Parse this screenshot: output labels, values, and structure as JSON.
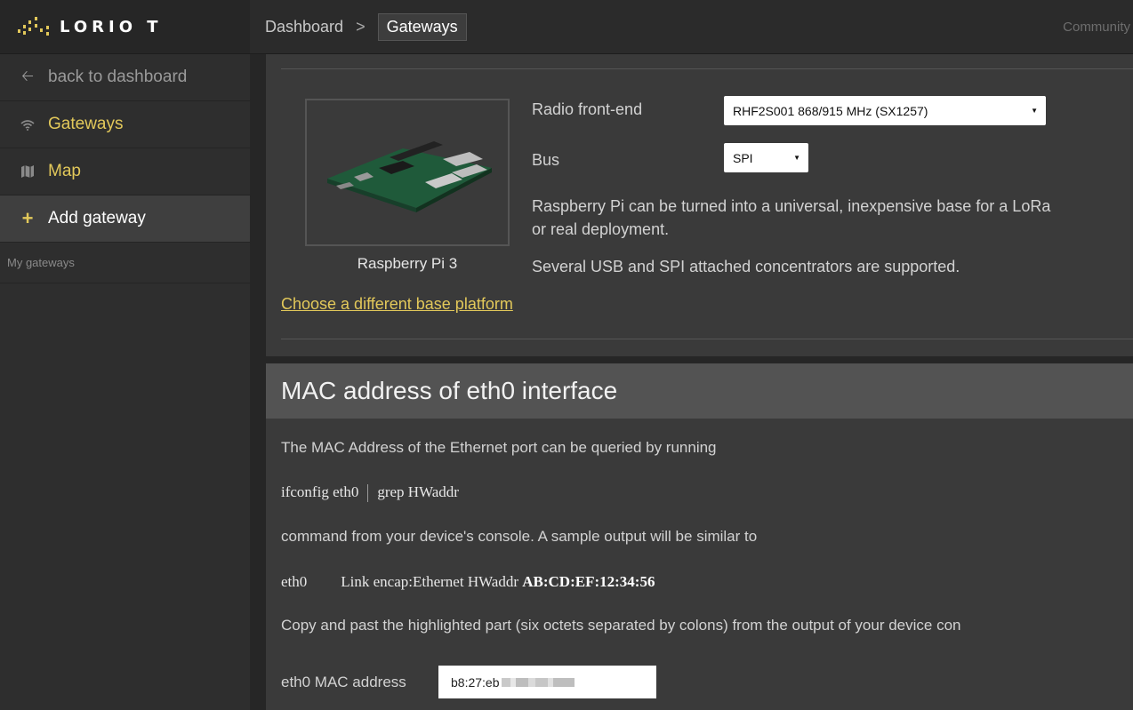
{
  "brand": {
    "logo_text": "LORIO T"
  },
  "sidebar": {
    "back": "back to dashboard",
    "gateways": "Gateways",
    "map": "Map",
    "add_gateway": "Add gateway",
    "section_my_gateways": "My gateways"
  },
  "header": {
    "crumb_dashboard": "Dashboard",
    "crumb_sep": ">",
    "crumb_current": "Gateways",
    "community": "Community N"
  },
  "platform": {
    "board_caption": "Raspberry Pi 3",
    "radio_label": "Radio front-end",
    "radio_value": "RHF2S001 868/915 MHz (SX1257)",
    "bus_label": "Bus",
    "bus_value": "SPI",
    "description_1": "Raspberry Pi can be turned into a universal, inexpensive base for a LoRa",
    "description_2": "or real deployment.",
    "description_3": "Several USB and SPI attached concentrators are supported.",
    "choose_link": "Choose a different base platform"
  },
  "mac_section": {
    "title": "MAC address of eth0 interface",
    "intro": "The MAC Address of the Ethernet port can be queried by running",
    "cmd_part1": "ifconfig eth0",
    "cmd_part2": "grep HWaddr",
    "after_cmd": "command from your device's console. A sample output will be similar to",
    "sample_prefix": "eth0",
    "sample_mid": "Link encap:Ethernet HWaddr",
    "sample_mac": "AB:CD:EF:12:34:56",
    "copy_note": "Copy and past the highlighted part (six octets separated by colons) from the output of your device con",
    "field_label": "eth0 MAC address",
    "field_value": "b8:27:eb"
  },
  "colors": {
    "accent": "#e2c85a",
    "panel": "#3a3a3a",
    "sidebar": "#2e2e2e",
    "header_panel": "#535353"
  },
  "icons": {
    "back": "arrow-left-icon",
    "gateways": "wifi-icon",
    "map": "map-icon",
    "add": "plus-icon",
    "dropdown": "caret-down-icon"
  }
}
